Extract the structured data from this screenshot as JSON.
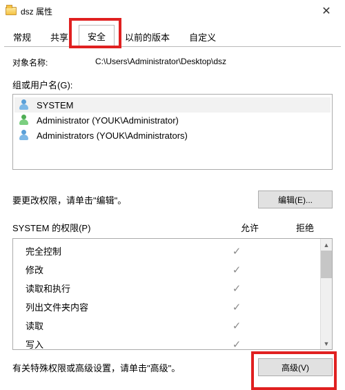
{
  "window": {
    "title": "dsz 属性",
    "close_glyph": "✕"
  },
  "tabs": {
    "general": "常规",
    "sharing": "共享",
    "security": "安全",
    "previous": "以前的版本",
    "customize": "自定义"
  },
  "object": {
    "label": "对象名称:",
    "path": "C:\\Users\\Administrator\\Desktop\\dsz"
  },
  "groups": {
    "label": "组或用户名(G):",
    "items": [
      {
        "icon": "users",
        "name": "SYSTEM"
      },
      {
        "icon": "user",
        "name": "Administrator (YOUK\\Administrator)"
      },
      {
        "icon": "users",
        "name": "Administrators (YOUK\\Administrators)"
      }
    ]
  },
  "edit": {
    "hint": "要更改权限，请单击\"编辑\"。",
    "button": "编辑(E)..."
  },
  "permissions": {
    "header": "SYSTEM 的权限(P)",
    "col_allow": "允许",
    "col_deny": "拒绝",
    "check": "✓",
    "rows": [
      {
        "name": "完全控制",
        "allow": true,
        "deny": false
      },
      {
        "name": "修改",
        "allow": true,
        "deny": false
      },
      {
        "name": "读取和执行",
        "allow": true,
        "deny": false
      },
      {
        "name": "列出文件夹内容",
        "allow": true,
        "deny": false
      },
      {
        "name": "读取",
        "allow": true,
        "deny": false
      },
      {
        "name": "写入",
        "allow": true,
        "deny": false
      }
    ]
  },
  "advanced": {
    "hint": "有关特殊权限或高级设置，请单击\"高级\"。",
    "button": "高级(V)"
  }
}
